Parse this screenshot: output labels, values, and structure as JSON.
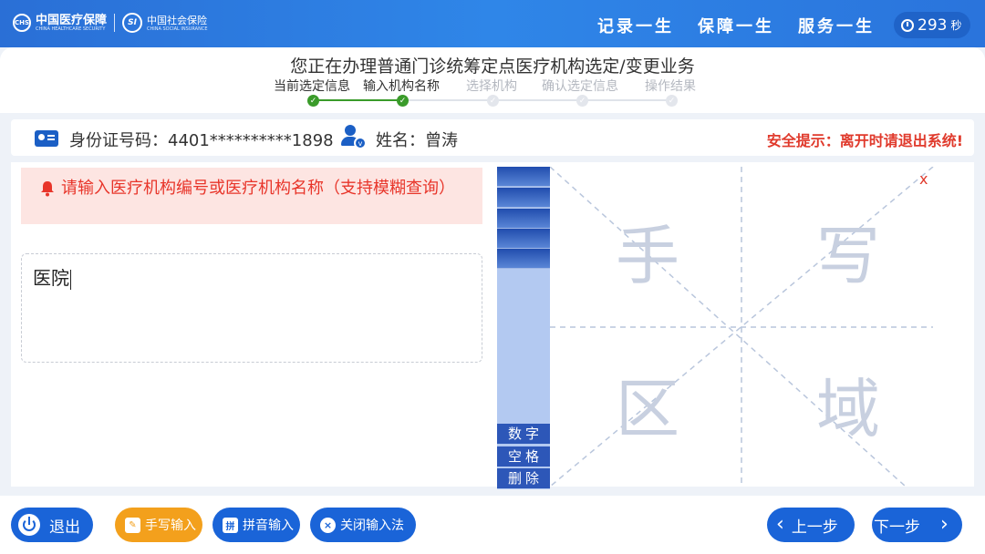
{
  "header": {
    "brand_primary_cn": "中国医疗保障",
    "brand_primary_en": "CHINA HEALTHCARE SECURITY",
    "brand_secondary_cn": "中国社会保险",
    "brand_secondary_en": "CHINA SOCIAL INSURANCE",
    "slogans": [
      "记录一生",
      "保障一生",
      "服务一生"
    ],
    "timer_value": "293",
    "timer_unit": "秒"
  },
  "page": {
    "title": "您正在办理普通门诊统筹定点医疗机构选定/变更业务",
    "steps": [
      {
        "label": "当前选定信息",
        "state": "done"
      },
      {
        "label": "输入机构名称",
        "state": "done"
      },
      {
        "label": "选择机构",
        "state": "todo"
      },
      {
        "label": "确认选定信息",
        "state": "todo"
      },
      {
        "label": "操作结果",
        "state": "todo"
      }
    ]
  },
  "info": {
    "id_label": "身份证号码：",
    "id_value": "4401**********1898",
    "name_label": "姓名：",
    "name_value": "曾涛",
    "security_tip": "安全提示：离开时请退出系统!"
  },
  "main": {
    "alert_text": "请输入医疗机构编号或医疗机构名称（支持模糊查询）",
    "input_value": "医院"
  },
  "keypad": {
    "number_label": "数字",
    "space_label": "空格",
    "delete_label": "删除"
  },
  "handwriting": {
    "close_label": "x",
    "chars": [
      "手",
      "写",
      "区",
      "域"
    ]
  },
  "footer": {
    "exit_label": "退出",
    "handwrite_label": "手写输入",
    "pinyin_label": "拼音输入",
    "close_ime_label": "关闭输入法",
    "prev_label": "上一步",
    "next_label": "下一步"
  },
  "colors": {
    "primary": "#1a64d8",
    "accent_orange": "#f3a01c",
    "alert_red": "#e8352a",
    "step_done": "#3a9b2a"
  }
}
